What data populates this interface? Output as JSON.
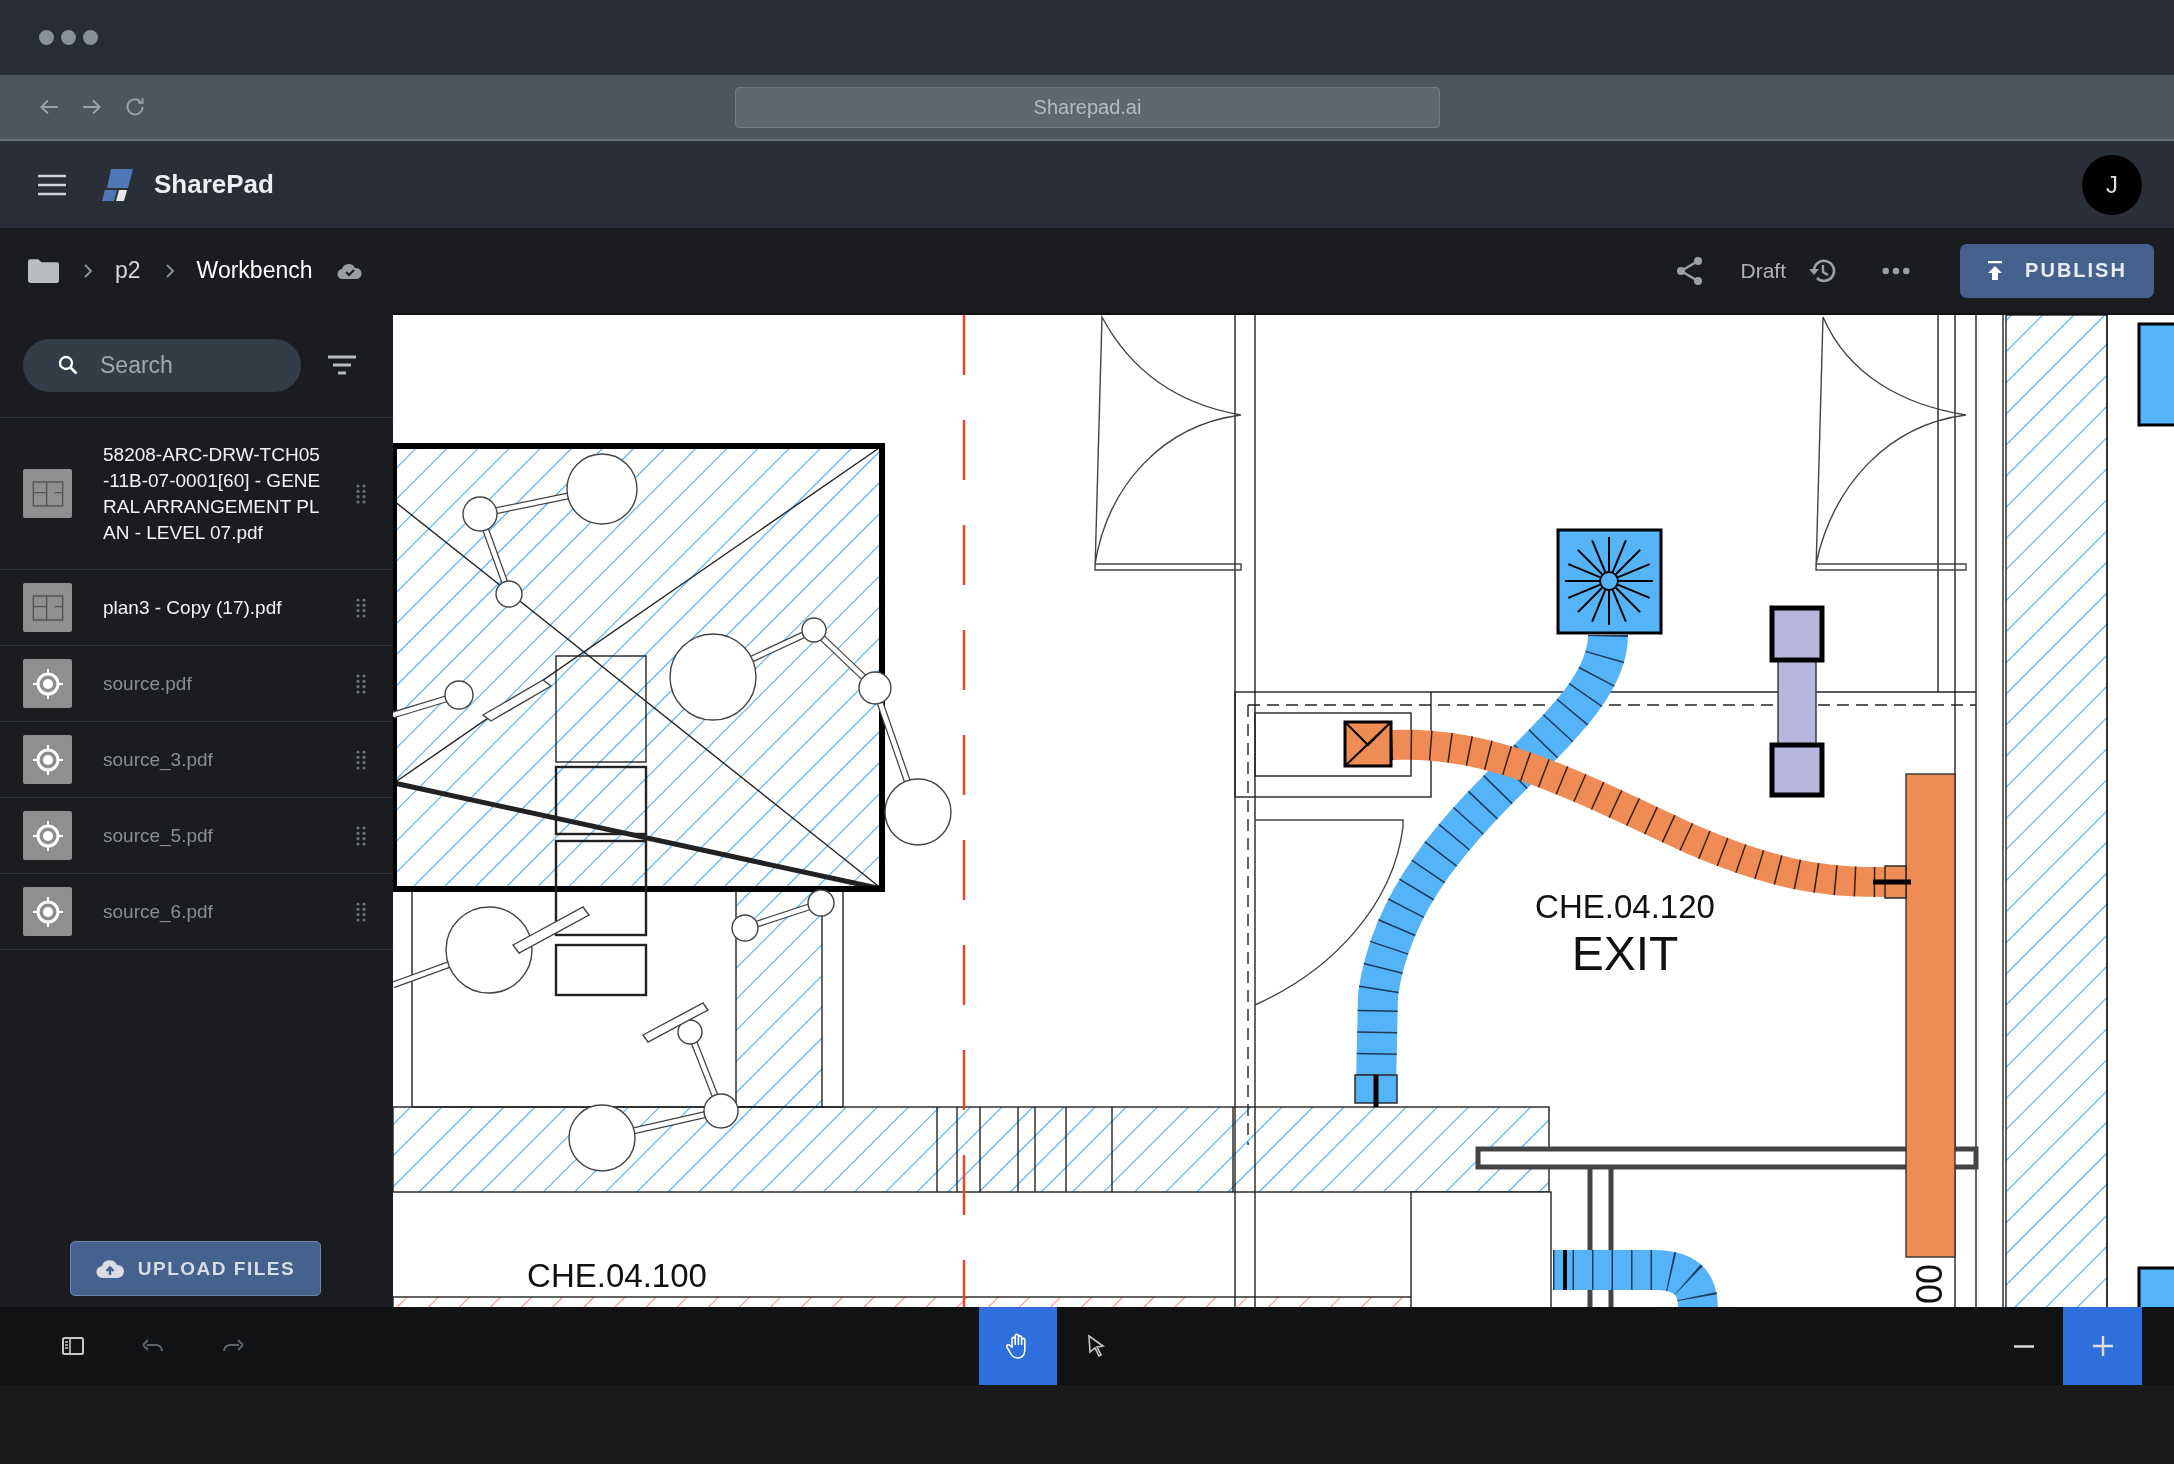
{
  "browser": {
    "address": "Sharepad.ai"
  },
  "app": {
    "name": "SharePad",
    "avatar": "J"
  },
  "breadcrumb": [
    {
      "label": "p2",
      "current": false
    },
    {
      "label": "Workbench",
      "current": true
    }
  ],
  "toolbar": {
    "status": "Draft",
    "publish": "PUBLISH"
  },
  "sidebar": {
    "search": {
      "placeholder": "Search"
    },
    "files": [
      {
        "name": "58208-ARC-DRW-TCH05-11B-07-0001[60] - GENERAL ARRANGEMENT PLAN - LEVEL 07.pdf",
        "processed": true
      },
      {
        "name": "plan3 - Copy (17).pdf",
        "processed": true
      },
      {
        "name": "source.pdf",
        "processed": false
      },
      {
        "name": "source_3.pdf",
        "processed": false
      },
      {
        "name": "source_5.pdf",
        "processed": false
      },
      {
        "name": "source_6.pdf",
        "processed": false
      }
    ],
    "upload": "UPLOAD FILES"
  },
  "canvas": {
    "labels": [
      {
        "kind": "room",
        "text": "CHE.04.120"
      },
      {
        "kind": "name",
        "text": "EXIT"
      },
      {
        "kind": "room",
        "text": "CHE.04.100"
      },
      {
        "kind": "tag",
        "text": "00"
      }
    ]
  },
  "bottom_bar": {
    "history": [
      {
        "kind": "undo",
        "disabled": true
      },
      {
        "kind": "redo",
        "disabled": true
      }
    ],
    "tools": [
      {
        "kind": "hand",
        "selected": true
      },
      {
        "kind": "pointer",
        "selected": false
      }
    ],
    "zoom": [
      {
        "kind": "out",
        "active": false
      },
      {
        "kind": "in",
        "active": true
      }
    ]
  }
}
